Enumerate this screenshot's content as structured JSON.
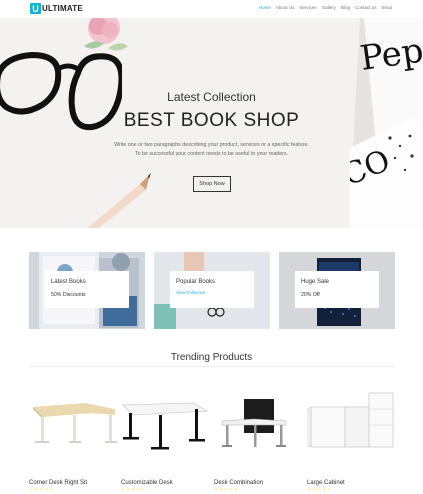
{
  "brand": {
    "mark": "U",
    "name": "ULTIMATE"
  },
  "nav": {
    "items": [
      "Home",
      "About Us",
      "Services",
      "Gallery",
      "Blog",
      "Contact us",
      "Shop"
    ]
  },
  "hero": {
    "subtitle": "Latest Collection",
    "title": "BEST BOOK SHOP",
    "desc1": "Write one or two paragraphs describing your product, services or a specific feature.",
    "desc2": "To be successful your content needs to be useful to your readers.",
    "button": "Shop Now",
    "book_text": "Pep",
    "book_text2": "CO"
  },
  "cards": [
    {
      "title": "Latest Books",
      "sub": "50% Discounts",
      "link": ""
    },
    {
      "title": "Popular Books",
      "sub": "",
      "link": "View Collection"
    },
    {
      "title": "Huge Sale",
      "sub": "20% Off",
      "link": ""
    }
  ],
  "trending": {
    "title": "Trending Products",
    "products": [
      {
        "name": "Corner Desk Right Sit",
        "stars": "☆☆☆☆☆"
      },
      {
        "name": "Customizable Desk",
        "stars": "☆☆☆☆☆"
      },
      {
        "name": "Desk Combination",
        "stars": "☆☆☆☆☆"
      },
      {
        "name": "Large Cabinet",
        "stars": "☆☆☆☆☆"
      }
    ]
  },
  "colors": {
    "accent": "#1bb0d8",
    "star": "#f1c21b"
  }
}
